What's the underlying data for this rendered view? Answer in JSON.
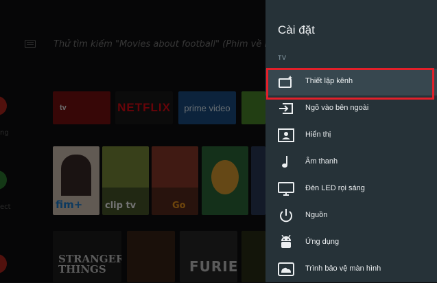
{
  "background": {
    "search_hint": "Thử tìm kiếm \"Movies about football\" (Phim về bóng đá)",
    "side_labels": [
      "ng",
      "ect"
    ],
    "apps": [
      "tv",
      "NETFLIX",
      "prime video"
    ],
    "posters": [
      "fim+",
      "clip tv",
      "Go"
    ],
    "movies": [
      "STRANGER THINGS",
      "FURIE"
    ]
  },
  "panel": {
    "title": "Cài đặt",
    "section": "TV",
    "items": [
      {
        "label": "Thiết lập kênh",
        "icon": "channel-setup-icon"
      },
      {
        "label": "Ngõ vào bên ngoài",
        "icon": "input-icon"
      },
      {
        "label": "Hiển thị",
        "icon": "display-icon"
      },
      {
        "label": "Âm thanh",
        "icon": "music-note-icon"
      },
      {
        "label": "Đèn LED rọi sáng",
        "icon": "led-monitor-icon"
      },
      {
        "label": "Nguồn",
        "icon": "power-icon"
      },
      {
        "label": "Ứng dụng",
        "icon": "android-icon"
      },
      {
        "label": "Trình bảo vệ màn hình",
        "icon": "screensaver-icon"
      }
    ]
  },
  "colors": {
    "panel": "#263238",
    "highlight": "#e2202a",
    "text": "#eceff1"
  }
}
